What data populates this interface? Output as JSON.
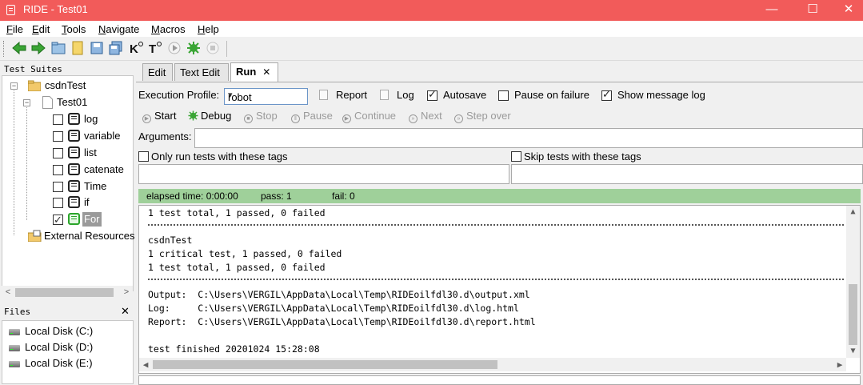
{
  "window": {
    "title": "RIDE - Test01",
    "minimize": "—",
    "maximize": "☐",
    "close": "✕"
  },
  "menu": [
    {
      "label": "File",
      "u": "F",
      "rest": "ile"
    },
    {
      "label": "Edit",
      "u": "E",
      "rest": "dit"
    },
    {
      "label": "Tools",
      "u": "T",
      "rest": "ools"
    },
    {
      "label": "Navigate",
      "u": "N",
      "rest": "avigate"
    },
    {
      "label": "Macros",
      "u": "M",
      "rest": "acros"
    },
    {
      "label": "Help",
      "u": "H",
      "rest": "elp"
    }
  ],
  "toolbar_icons": [
    "back-icon",
    "forward-icon",
    "open-folder-icon",
    "new-file-icon",
    "save-icon",
    "save-all-icon",
    "keyword-search-icon",
    "test-search-icon",
    "run-icon",
    "debug-icon",
    "stop-icon"
  ],
  "left": {
    "suites_header": "Test Suites",
    "tree": {
      "suite": "csdnTest",
      "testfile": "Test01",
      "tests": [
        {
          "label": "log",
          "checked": false
        },
        {
          "label": "variable",
          "checked": false
        },
        {
          "label": "list",
          "checked": false
        },
        {
          "label": "catenate",
          "checked": false
        },
        {
          "label": "Time",
          "checked": false
        },
        {
          "label": "if",
          "checked": false
        },
        {
          "label": "For",
          "checked": true
        }
      ],
      "external": "External Resources"
    },
    "files_header": "Files",
    "files_close": "✕",
    "disks": [
      "Local Disk (C:)",
      "Local Disk (D:)",
      "Local Disk (E:)"
    ]
  },
  "tabs": [
    {
      "label": "Edit",
      "active": false
    },
    {
      "label": "Text Edit",
      "active": false
    },
    {
      "label": "Run",
      "active": true,
      "close": "✕"
    }
  ],
  "run": {
    "profile_label": "Execution Profile:",
    "profile_value": "robot",
    "report": "Report",
    "log": "Log",
    "autosave": "Autosave",
    "pause_on_failure": "Pause on failure",
    "show_message_log": "Show message log",
    "buttons": {
      "start": "Start",
      "debug": "Debug",
      "stop": "Stop",
      "pause": "Pause",
      "continue": "Continue",
      "next": "Next",
      "step_over": "Step over"
    },
    "arguments_label": "Arguments:",
    "only_run_tags": "Only run tests with these tags",
    "skip_tags": "Skip tests with these tags",
    "status": {
      "elapsed": "elapsed time: 0:00:00",
      "pass": "pass: 1",
      "fail": "fail: 0",
      "color": "#9fd09a"
    },
    "output": {
      "line1": "1 test total, 1 passed, 0 failed",
      "line2": "csdnTest",
      "line3": "1 critical test, 1 passed, 0 failed",
      "line4": "1 test total, 1 passed, 0 failed",
      "output_line": "Output:  C:\\Users\\VERGIL\\AppData\\Local\\Temp\\RIDEoilfdl30.d\\output.xml",
      "log_line": "Log:     C:\\Users\\VERGIL\\AppData\\Local\\Temp\\RIDEoilfdl30.d\\log.html",
      "report_line": "Report:  C:\\Users\\VERGIL\\AppData\\Local\\Temp\\RIDEoilfdl30.d\\report.html",
      "finished": "test finished 20201024 15:28:08"
    }
  }
}
